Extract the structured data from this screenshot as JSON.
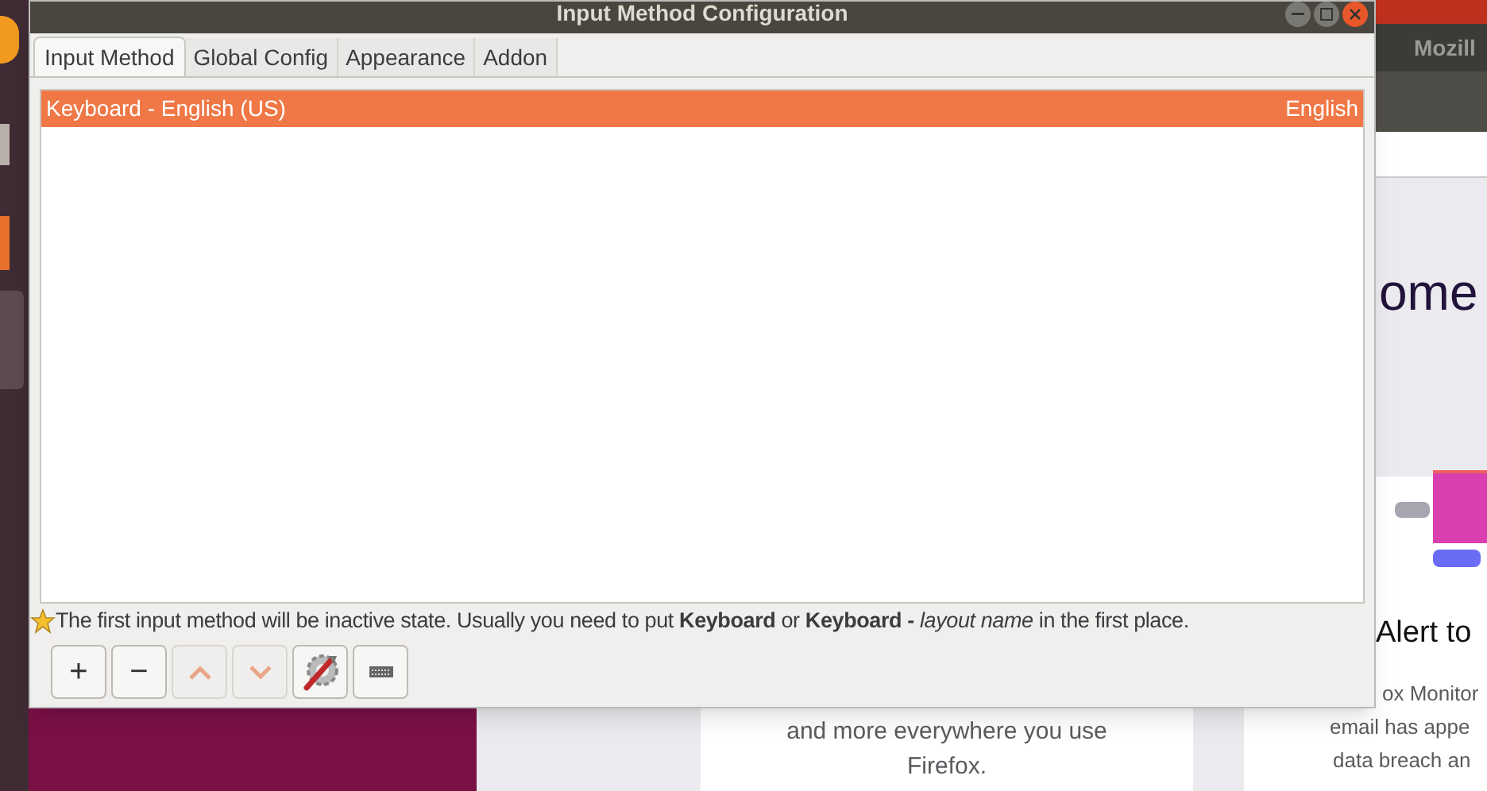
{
  "window": {
    "title": "Input Method Configuration"
  },
  "tabs": [
    {
      "label": "Input Method",
      "selected": true
    },
    {
      "label": "Global Config",
      "selected": false
    },
    {
      "label": "Appearance",
      "selected": false
    },
    {
      "label": "Addon",
      "selected": false
    }
  ],
  "input_methods": [
    {
      "name": "Keyboard - English (US)",
      "language": "English",
      "selected": true
    }
  ],
  "hint": "The first input method will be inactive state. Usually you need to put **Keyboard** or **Keyboard -** *layout name* in the first place.",
  "toolbar": [
    {
      "kind": "add",
      "label": "+",
      "disabled": false
    },
    {
      "kind": "remove",
      "label": "−",
      "disabled": false
    },
    {
      "kind": "up",
      "disabled": true
    },
    {
      "kind": "down",
      "disabled": true
    },
    {
      "kind": "configure",
      "disabled": false
    },
    {
      "kind": "keyboard",
      "disabled": false
    }
  ],
  "background_browser": {
    "tab": "Mozill",
    "heading": "ome",
    "card_1_lines": [
      "and more everywhere you use",
      "Firefox."
    ],
    "card_2_title": "Alert to",
    "card_2_lines": [
      "ox Monitor",
      "email has appe",
      "data breach an"
    ]
  }
}
